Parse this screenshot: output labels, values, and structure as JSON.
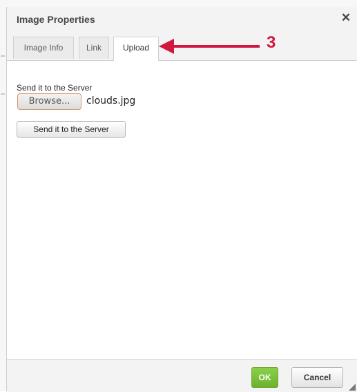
{
  "dialog": {
    "title": "Image Properties",
    "close_glyph": "✕"
  },
  "tabs": [
    {
      "label": "Image Info",
      "active": false
    },
    {
      "label": "Link",
      "active": false
    },
    {
      "label": "Upload",
      "active": true
    }
  ],
  "upload": {
    "section_label": "Send it to the Server",
    "browse_label": "Browse...",
    "file_name": "clouds.jpg",
    "send_button_label": "Send it to the Server"
  },
  "footer": {
    "ok_label": "OK",
    "cancel_label": "Cancel"
  },
  "annotation": {
    "step_number": "3",
    "color": "#d0183f"
  },
  "colors": {
    "ok_green": "#78be39",
    "browse_border": "#d8936a"
  }
}
